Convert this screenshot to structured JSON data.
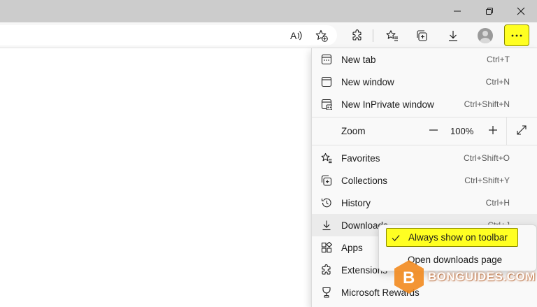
{
  "titlebar": {
    "controls": [
      "minimize-icon",
      "restore-icon",
      "close-icon"
    ]
  },
  "toolbar": {
    "icons": [
      "read-aloud-icon",
      "add-favorite-icon",
      "extensions-icon",
      "favorites-icon",
      "collections-icon",
      "downloads-icon",
      "profile-icon",
      "more-icon"
    ],
    "highlight_color": "#ffff22"
  },
  "menu": {
    "items": [
      {
        "label": "New tab",
        "shortcut": "Ctrl+T",
        "icon": "new-tab-icon"
      },
      {
        "label": "New window",
        "shortcut": "Ctrl+N",
        "icon": "new-window-icon"
      },
      {
        "label": "New InPrivate window",
        "shortcut": "Ctrl+Shift+N",
        "icon": "inprivate-icon"
      }
    ],
    "zoom": {
      "label": "Zoom",
      "minus": "—",
      "value": "100%",
      "plus": "+",
      "icon": "fullscreen-icon"
    },
    "items2": [
      {
        "label": "Favorites",
        "shortcut": "Ctrl+Shift+O",
        "icon": "favorites-icon"
      },
      {
        "label": "Collections",
        "shortcut": "Ctrl+Shift+Y",
        "icon": "collections-icon"
      },
      {
        "label": "History",
        "shortcut": "Ctrl+H",
        "icon": "history-icon"
      },
      {
        "label": "Downloads",
        "shortcut": "Ctrl+J",
        "icon": "downloads-icon"
      },
      {
        "label": "Apps",
        "shortcut": "",
        "icon": "apps-icon"
      },
      {
        "label": "Extensions",
        "shortcut": "",
        "icon": "extensions-icon"
      },
      {
        "label": "Microsoft Rewards",
        "shortcut": "",
        "icon": "rewards-icon"
      }
    ]
  },
  "submenu": {
    "always_show": "Always show on toolbar",
    "open_page": "Open downloads page"
  },
  "watermark": {
    "text": "BONGUIDES.COM"
  }
}
